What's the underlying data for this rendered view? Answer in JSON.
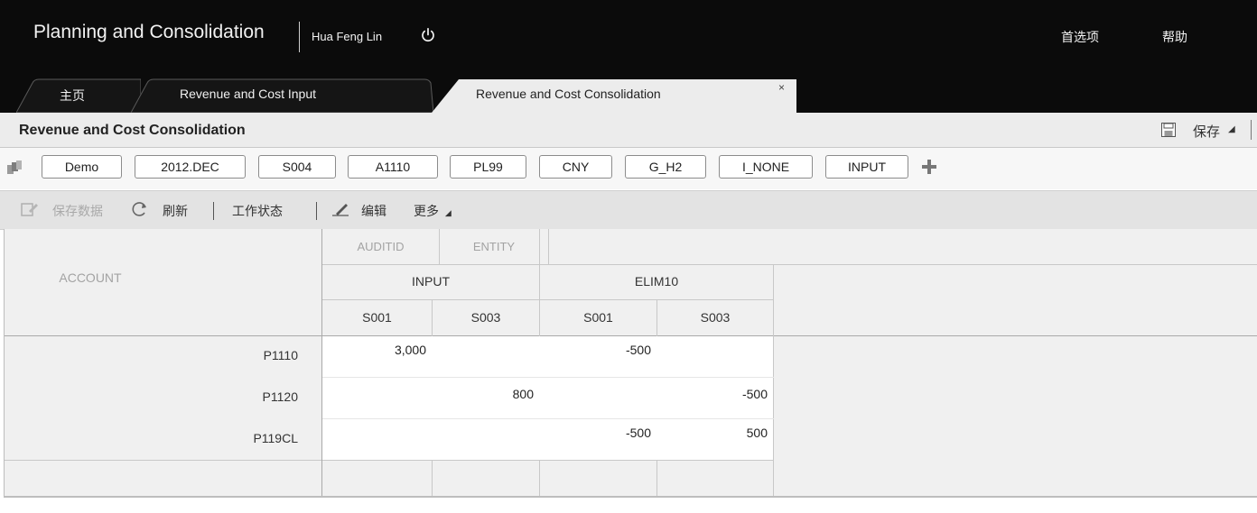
{
  "header": {
    "app_title": "Planning and Consolidation",
    "user_name": "Hua Feng Lin",
    "preferences": "首选项",
    "help": "帮助"
  },
  "tabs": [
    {
      "label": "主页",
      "active": false
    },
    {
      "label": "Revenue and Cost Input",
      "active": false
    },
    {
      "label": "Revenue and Cost Consolidation",
      "active": true
    }
  ],
  "tab_close": "×",
  "page": {
    "title": "Revenue and Cost Consolidation",
    "save_label": "保存",
    "save_caret": "◢"
  },
  "context": {
    "dimensions": [
      "Demo",
      "2012.DEC",
      "S004",
      "A1110",
      "PL99",
      "CNY",
      "G_H2",
      "I_NONE",
      "INPUT"
    ]
  },
  "toolbar": {
    "save_data": "保存数据",
    "refresh": "刷新",
    "work_status": "工作状态",
    "edit": "编辑",
    "more": "更多",
    "more_caret": "◢"
  },
  "grid": {
    "corner_label": "ACCOUNT",
    "col_dims": [
      "AUDITID",
      "ENTITY"
    ],
    "groups": [
      "INPUT",
      "ELIM10"
    ],
    "entities": [
      "S001",
      "S003",
      "S001",
      "S003"
    ],
    "rows": [
      {
        "account": "P1110",
        "values": [
          "3,000",
          "",
          "-500",
          ""
        ]
      },
      {
        "account": "P1120",
        "values": [
          "",
          "800",
          "",
          "-500"
        ]
      },
      {
        "account": "P119CL",
        "values": [
          "",
          "",
          "-500",
          "500"
        ]
      }
    ]
  },
  "colors": {
    "header_bg": "#0b0b0b",
    "toolbar_bg": "#e3e3e3",
    "grid_bg": "#f0f0f0"
  }
}
